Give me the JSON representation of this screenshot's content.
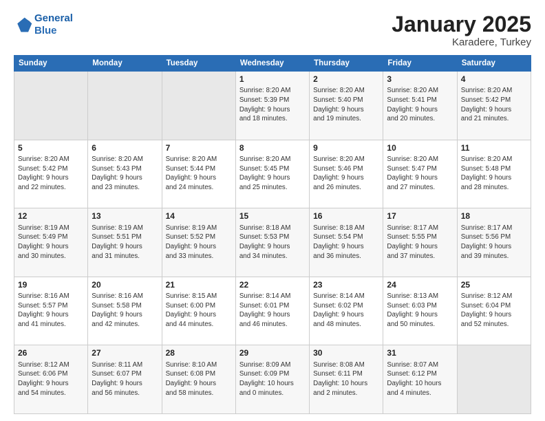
{
  "header": {
    "logo_line1": "General",
    "logo_line2": "Blue",
    "title": "January 2025",
    "subtitle": "Karadere, Turkey"
  },
  "weekdays": [
    "Sunday",
    "Monday",
    "Tuesday",
    "Wednesday",
    "Thursday",
    "Friday",
    "Saturday"
  ],
  "weeks": [
    [
      {
        "day": "",
        "detail": ""
      },
      {
        "day": "",
        "detail": ""
      },
      {
        "day": "",
        "detail": ""
      },
      {
        "day": "1",
        "detail": "Sunrise: 8:20 AM\nSunset: 5:39 PM\nDaylight: 9 hours\nand 18 minutes."
      },
      {
        "day": "2",
        "detail": "Sunrise: 8:20 AM\nSunset: 5:40 PM\nDaylight: 9 hours\nand 19 minutes."
      },
      {
        "day": "3",
        "detail": "Sunrise: 8:20 AM\nSunset: 5:41 PM\nDaylight: 9 hours\nand 20 minutes."
      },
      {
        "day": "4",
        "detail": "Sunrise: 8:20 AM\nSunset: 5:42 PM\nDaylight: 9 hours\nand 21 minutes."
      }
    ],
    [
      {
        "day": "5",
        "detail": "Sunrise: 8:20 AM\nSunset: 5:42 PM\nDaylight: 9 hours\nand 22 minutes."
      },
      {
        "day": "6",
        "detail": "Sunrise: 8:20 AM\nSunset: 5:43 PM\nDaylight: 9 hours\nand 23 minutes."
      },
      {
        "day": "7",
        "detail": "Sunrise: 8:20 AM\nSunset: 5:44 PM\nDaylight: 9 hours\nand 24 minutes."
      },
      {
        "day": "8",
        "detail": "Sunrise: 8:20 AM\nSunset: 5:45 PM\nDaylight: 9 hours\nand 25 minutes."
      },
      {
        "day": "9",
        "detail": "Sunrise: 8:20 AM\nSunset: 5:46 PM\nDaylight: 9 hours\nand 26 minutes."
      },
      {
        "day": "10",
        "detail": "Sunrise: 8:20 AM\nSunset: 5:47 PM\nDaylight: 9 hours\nand 27 minutes."
      },
      {
        "day": "11",
        "detail": "Sunrise: 8:20 AM\nSunset: 5:48 PM\nDaylight: 9 hours\nand 28 minutes."
      }
    ],
    [
      {
        "day": "12",
        "detail": "Sunrise: 8:19 AM\nSunset: 5:49 PM\nDaylight: 9 hours\nand 30 minutes."
      },
      {
        "day": "13",
        "detail": "Sunrise: 8:19 AM\nSunset: 5:51 PM\nDaylight: 9 hours\nand 31 minutes."
      },
      {
        "day": "14",
        "detail": "Sunrise: 8:19 AM\nSunset: 5:52 PM\nDaylight: 9 hours\nand 33 minutes."
      },
      {
        "day": "15",
        "detail": "Sunrise: 8:18 AM\nSunset: 5:53 PM\nDaylight: 9 hours\nand 34 minutes."
      },
      {
        "day": "16",
        "detail": "Sunrise: 8:18 AM\nSunset: 5:54 PM\nDaylight: 9 hours\nand 36 minutes."
      },
      {
        "day": "17",
        "detail": "Sunrise: 8:17 AM\nSunset: 5:55 PM\nDaylight: 9 hours\nand 37 minutes."
      },
      {
        "day": "18",
        "detail": "Sunrise: 8:17 AM\nSunset: 5:56 PM\nDaylight: 9 hours\nand 39 minutes."
      }
    ],
    [
      {
        "day": "19",
        "detail": "Sunrise: 8:16 AM\nSunset: 5:57 PM\nDaylight: 9 hours\nand 41 minutes."
      },
      {
        "day": "20",
        "detail": "Sunrise: 8:16 AM\nSunset: 5:58 PM\nDaylight: 9 hours\nand 42 minutes."
      },
      {
        "day": "21",
        "detail": "Sunrise: 8:15 AM\nSunset: 6:00 PM\nDaylight: 9 hours\nand 44 minutes."
      },
      {
        "day": "22",
        "detail": "Sunrise: 8:14 AM\nSunset: 6:01 PM\nDaylight: 9 hours\nand 46 minutes."
      },
      {
        "day": "23",
        "detail": "Sunrise: 8:14 AM\nSunset: 6:02 PM\nDaylight: 9 hours\nand 48 minutes."
      },
      {
        "day": "24",
        "detail": "Sunrise: 8:13 AM\nSunset: 6:03 PM\nDaylight: 9 hours\nand 50 minutes."
      },
      {
        "day": "25",
        "detail": "Sunrise: 8:12 AM\nSunset: 6:04 PM\nDaylight: 9 hours\nand 52 minutes."
      }
    ],
    [
      {
        "day": "26",
        "detail": "Sunrise: 8:12 AM\nSunset: 6:06 PM\nDaylight: 9 hours\nand 54 minutes."
      },
      {
        "day": "27",
        "detail": "Sunrise: 8:11 AM\nSunset: 6:07 PM\nDaylight: 9 hours\nand 56 minutes."
      },
      {
        "day": "28",
        "detail": "Sunrise: 8:10 AM\nSunset: 6:08 PM\nDaylight: 9 hours\nand 58 minutes."
      },
      {
        "day": "29",
        "detail": "Sunrise: 8:09 AM\nSunset: 6:09 PM\nDaylight: 10 hours\nand 0 minutes."
      },
      {
        "day": "30",
        "detail": "Sunrise: 8:08 AM\nSunset: 6:11 PM\nDaylight: 10 hours\nand 2 minutes."
      },
      {
        "day": "31",
        "detail": "Sunrise: 8:07 AM\nSunset: 6:12 PM\nDaylight: 10 hours\nand 4 minutes."
      },
      {
        "day": "",
        "detail": ""
      }
    ]
  ]
}
